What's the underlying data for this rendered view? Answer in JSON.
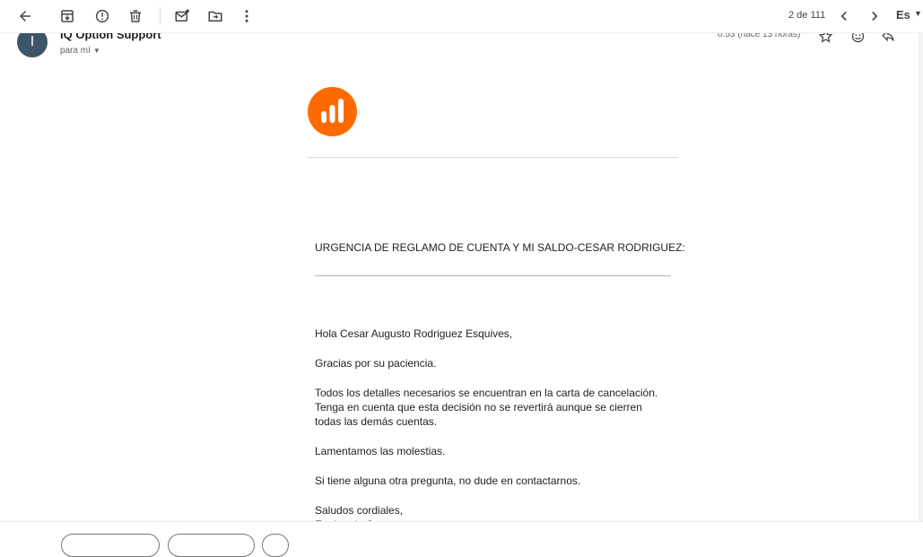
{
  "toolbar": {
    "pager": "2 de 111",
    "language": "Es",
    "icons": [
      "back-arrow-icon",
      "archive-icon",
      "report-spam-icon",
      "delete-icon",
      "mark-unread-icon",
      "move-to-icon",
      "more-vert-icon",
      "prev-icon",
      "next-icon"
    ]
  },
  "email": {
    "avatar_letter": "I",
    "sender": "IQ Option Support",
    "to": "para mí",
    "timestamp": "0:53 (hace 13 horas)",
    "subject": "URGENCIA DE REGLAMO DE CUENTA Y MI SALDO-CESAR RODRIGUEZ:",
    "greeting": "Hola Cesar Augusto Rodriguez Esquives,",
    "p1": "Gracias por su paciencia.",
    "p2": "Todos los detalles necesarios se encuentran en la carta de cancelación. Tenga en cuenta que esta decisión no se revertirá aunque se cierren todas las demás cuentas.",
    "p3": "Lamentamos las molestias.",
    "p4": "Si tiene alguna otra pregunta, no dude en contactarnos.",
    "closing": "Saludos cordiales,",
    "signature": "Equipo de Soporte"
  },
  "colors": {
    "brand": "#ff6a00",
    "avatar": "#3c5568"
  }
}
